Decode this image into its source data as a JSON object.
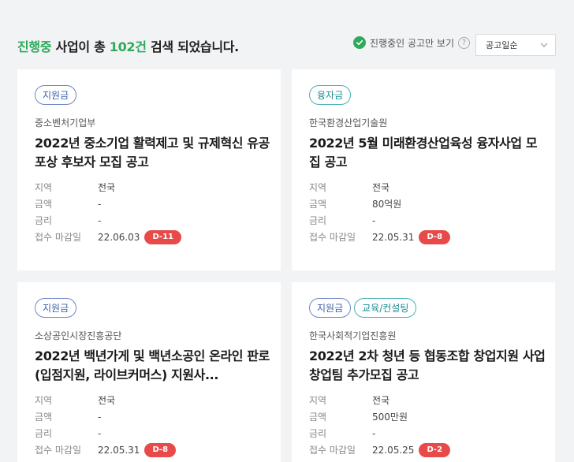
{
  "summary": {
    "status": "진행중",
    "text_before": " 사업이 총 ",
    "count": "102건",
    "text_after": " 검색 되었습니다."
  },
  "filter": {
    "label": "진행중인 공고만 보기",
    "help": "?",
    "checked": true
  },
  "sort": {
    "selected": "공고일순"
  },
  "info_labels": {
    "region": "지역",
    "amount": "금액",
    "rate": "금리",
    "deadline": "접수 마감일"
  },
  "cards": [
    {
      "tags": [
        "지원금"
      ],
      "org": "중소벤처기업부",
      "title": "2022년 중소기업 활력제고 및 규제혁신 유공 포상 후보자 모집 공고",
      "region": "전국",
      "amount": "-",
      "rate": "-",
      "deadline": "22.06.03",
      "dday": "D-11"
    },
    {
      "tags": [
        "융자금"
      ],
      "org": "한국환경산업기술원",
      "title": "2022년 5월 미래환경산업육성 융자사업 모집 공고",
      "region": "전국",
      "amount": "80억원",
      "rate": "-",
      "deadline": "22.05.31",
      "dday": "D-8"
    },
    {
      "tags": [
        "지원금"
      ],
      "org": "소상공인시장진흥공단",
      "title": "2022년 백년가게 및 백년소공인 온라인 판로(입점지원, 라이브커머스) 지원사...",
      "region": "전국",
      "amount": "-",
      "rate": "-",
      "deadline": "22.05.31",
      "dday": "D-8"
    },
    {
      "tags": [
        "지원금",
        "교육/컨설팅"
      ],
      "org": "한국사회적기업진흥원",
      "title": "2022년 2차 청년 등 협동조합 창업지원 사업 창업팀 추가모집 공고",
      "region": "전국",
      "amount": "500만원",
      "rate": "-",
      "deadline": "22.05.25",
      "dday": "D-2"
    }
  ],
  "colors": {
    "accent_green": "#2eaa5c",
    "dday_red": "#e84a4a",
    "tag_blue": "#3b5fa8",
    "tag_teal": "#1b8c92"
  }
}
